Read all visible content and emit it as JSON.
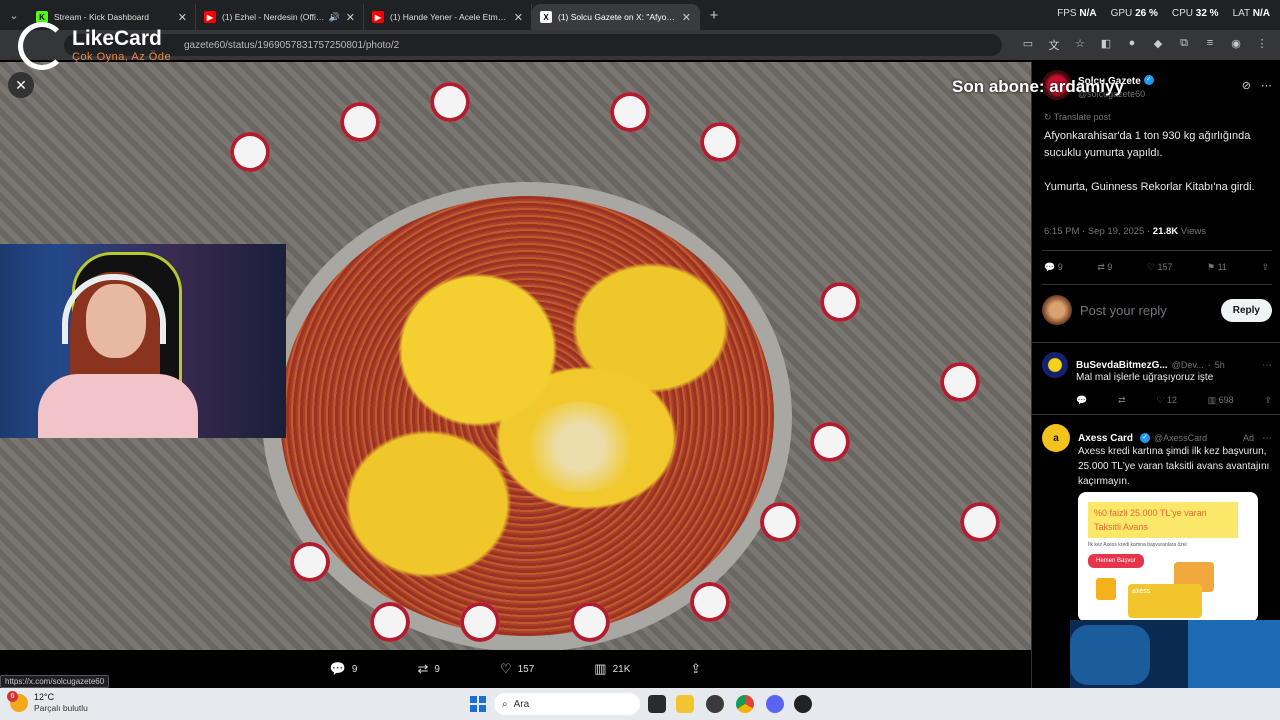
{
  "tabs": [
    {
      "title": "Stream - Kick Dashboard",
      "favicon": "K",
      "favicon_color": "#53fc18",
      "active": false
    },
    {
      "title": "(1) Ezhel - Nerdesin (Official A",
      "favicon": "▶",
      "favicon_color": "#ff0000",
      "active": false
    },
    {
      "title": "(1) Hande Yener - Acele Etme - Yo",
      "favicon": "▶",
      "favicon_color": "#ff0000",
      "active": false
    },
    {
      "title": "(1) Solcu Gazete on X: \"Afyonkara",
      "favicon": "X",
      "favicon_color": "#ffffff",
      "active": true
    }
  ],
  "perf": {
    "fps_label": "FPS",
    "fps": "N/A",
    "gpu_label": "GPU",
    "gpu": "26 %",
    "cpu_label": "CPU",
    "cpu": "32 %",
    "lat_label": "LAT",
    "lat": "N/A"
  },
  "address": {
    "url": "gazete60/status/1969057831757250801/photo/2"
  },
  "logo": {
    "name": "LikeCard",
    "tagline": "Çok Oyna, Az Öde"
  },
  "overlay": {
    "subscriber_text": "Son abone: ardamiyy"
  },
  "photo_actions": {
    "replies": "9",
    "reposts": "9",
    "likes": "157",
    "views": "21K"
  },
  "status_url": "https://x.com/solcugazete60",
  "tweet": {
    "author": "Solcu Gazete",
    "handle": "@solcugazete60",
    "translate": "Translate post",
    "text_1": "Afyonkarahisar'da 1 ton 930 kg ağırlığında sucuklu yumurta yapıldı.",
    "text_2": "Yumurta, Guinness Rekorlar Kitabı'na girdi.",
    "time": "6:15 PM · Sep 19, 2025 ·",
    "views_count": "21.8K",
    "views_label": "Views",
    "stats": {
      "replies": "9",
      "reposts": "9",
      "likes": "157",
      "bookmarks": "11"
    }
  },
  "reply_box": {
    "placeholder": "Post your reply",
    "button": "Reply"
  },
  "reply1": {
    "author": "BuSevdaBitmezG...",
    "handle": "@Dev...",
    "time": "5h",
    "text": "Mal mal işlerle uğraşıyoruz işte",
    "stats": {
      "reposts": "",
      "likes": "12",
      "views": "698"
    }
  },
  "ad": {
    "author": "Axess Card",
    "handle": "@AxessCard",
    "tag": "Ad",
    "text": "Axess kredi kartına şimdi ilk kez başvurun, 25.000 TL'ye varan taksitli avans avantajını kaçırmayın.",
    "banner": "%0 faizli 25.000 TL'ye varan Taksitli Avans",
    "small": "İlk kez Axess kredi kartına başvuranlara özel",
    "cta": "Hemen Başvur",
    "card_brand": "axess"
  },
  "taskbar": {
    "weather_badge": "6",
    "temperature": "12°C",
    "weather_desc": "Parçalı bulutlu",
    "search_placeholder": "Ara"
  }
}
